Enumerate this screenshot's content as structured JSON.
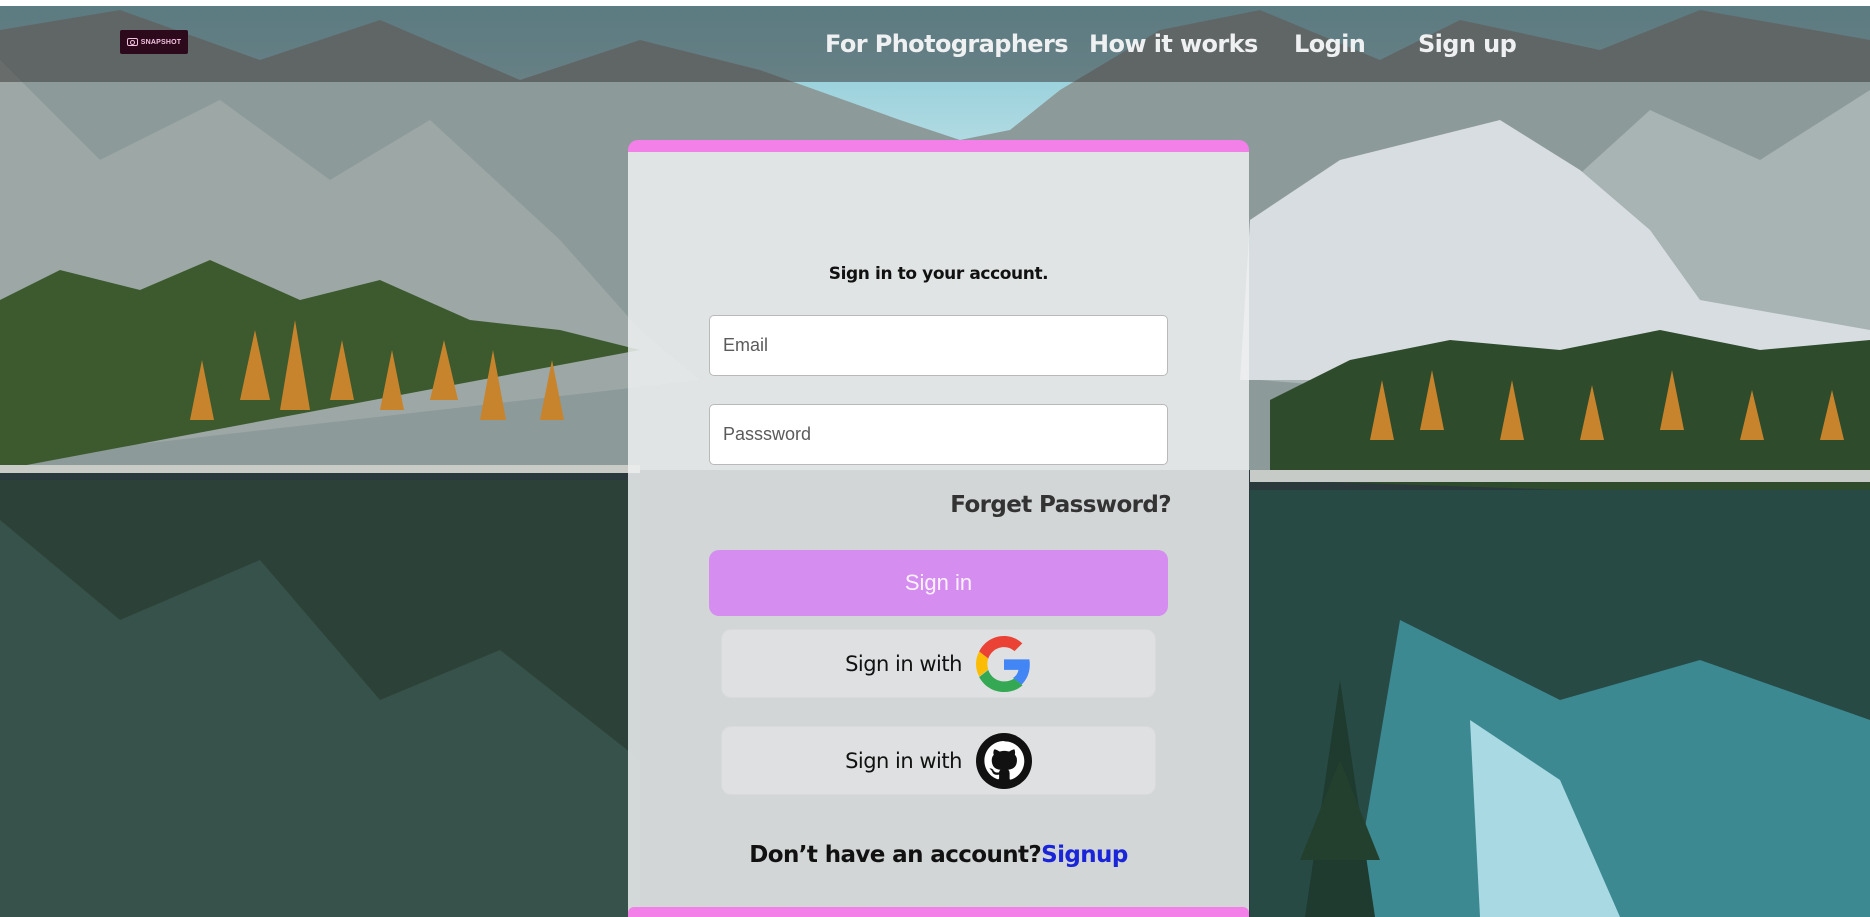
{
  "nav": {
    "logo_text": "SNAPSHOT",
    "links": [
      "For Photographers",
      "How it works",
      "Login",
      "Sign up"
    ]
  },
  "card": {
    "heading": "Sign in to your account.",
    "email_placeholder": "Email",
    "password_placeholder": "Passsword",
    "forgot_label": "Forget Password?",
    "signin_label": "Sign in",
    "google_label": "Sign in with",
    "github_label": "Sign in with",
    "no_account_text": "Don’t have an account?",
    "signup_link": "Signup"
  },
  "icons": {
    "camera": "camera-icon",
    "google": "google-icon",
    "github": "github-icon"
  },
  "colors": {
    "accent_pink": "#f37fe8",
    "button_purple": "#d58df0",
    "link_blue": "#1a24d9"
  }
}
